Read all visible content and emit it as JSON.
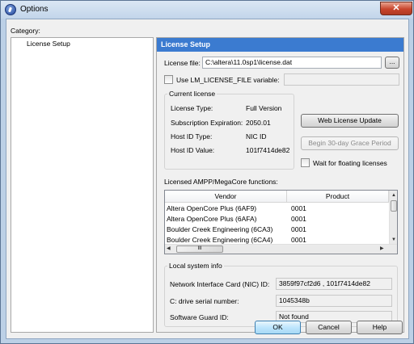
{
  "window": {
    "title": "Options",
    "close_glyph": "✕"
  },
  "category": {
    "label": "Category:",
    "items": [
      {
        "label": "License Setup"
      }
    ]
  },
  "panel": {
    "header": "License Setup",
    "license_file": {
      "label": "License file:",
      "value": "C:\\altera\\11.0sp1\\license.dat",
      "browse_label": "..."
    },
    "use_env": {
      "label": "Use LM_LICENSE_FILE variable:",
      "value": ""
    },
    "current_license": {
      "title": "Current license",
      "rows": [
        {
          "label": "License Type:",
          "value": "Full Version"
        },
        {
          "label": "Subscription Expiration:",
          "value": "2050.01"
        },
        {
          "label": "Host ID Type:",
          "value": "NIC ID"
        },
        {
          "label": "Host ID Value:",
          "value": "101f7414de82"
        }
      ]
    },
    "web_update_label": "Web License Update",
    "grace_label": "Begin 30-day Grace Period",
    "wait_floating_label": "Wait for floating licenses",
    "licensed_functions": {
      "label": "Licensed AMPP/MegaCore functions:",
      "columns": [
        "Vendor",
        "Product"
      ],
      "rows": [
        {
          "vendor": "Altera OpenCore Plus (6AF9)",
          "product": "0001"
        },
        {
          "vendor": "Altera OpenCore Plus (6AFA)",
          "product": "0001"
        },
        {
          "vendor": "Boulder Creek Engineering (6CA3)",
          "product": "0001"
        },
        {
          "vendor": "Boulder Creek Engineering (6CA4)",
          "product": "0001"
        }
      ],
      "thumb_glyph": "III"
    },
    "local_info": {
      "title": "Local system info",
      "rows": [
        {
          "label": "Network Interface Card (NIC) ID:",
          "value": "3859f97cf2d6 , 101f7414de82"
        },
        {
          "label": "C: drive serial number:",
          "value": "1045348b"
        },
        {
          "label": "Software Guard ID:",
          "value": "Not found"
        }
      ]
    }
  },
  "buttons": {
    "ok": "OK",
    "cancel": "Cancel",
    "help": "Help"
  }
}
